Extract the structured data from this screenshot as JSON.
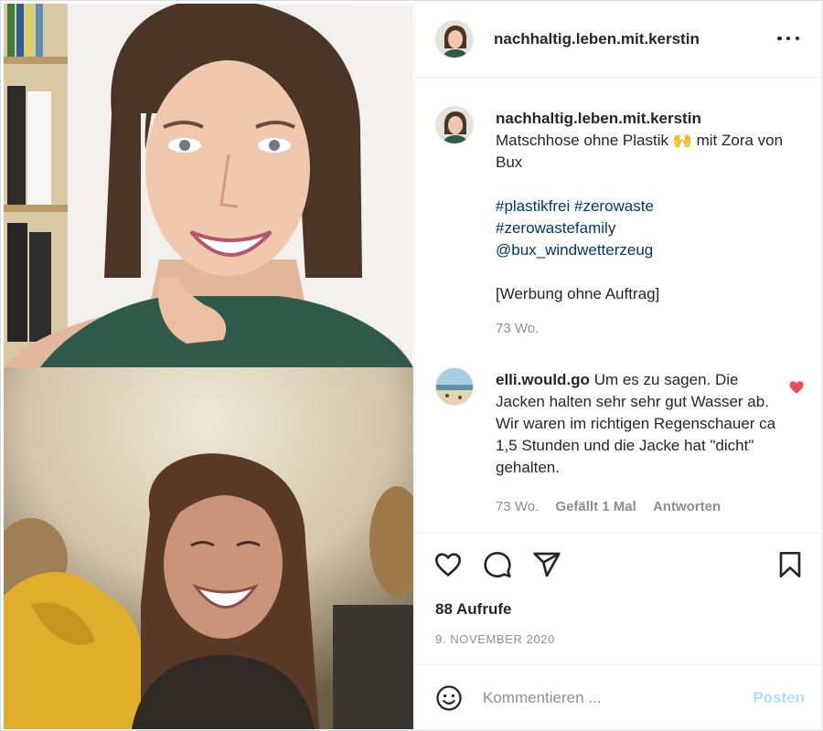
{
  "post": {
    "username": "nachhaltig.leben.mit.kerstin",
    "more_icon": "more-horizontal-icon"
  },
  "caption": {
    "username": "nachhaltig.leben.mit.kerstin",
    "line1": "Matschhose ohne Plastik 🙌 mit Zora von Bux",
    "hashtags": [
      "#plastikfrei",
      "#zerowaste",
      "#zerowastefamily",
      "@bux_windwetterzeug"
    ],
    "note": "[Werbung ohne Auftrag]",
    "time": "73 Wo."
  },
  "comment": {
    "username": "elli.would.go",
    "text": "Um es zu sagen. Die Jacken halten sehr sehr gut Wasser ab. Wir waren im richtigen Regenschauer ca 1,5 Stunden und die Jacke hat \"dicht\" gehalten.",
    "time": "73 Wo.",
    "likes": "Gefällt 1 Mal",
    "reply": "Antworten",
    "liked_color": "#ed4956"
  },
  "actions": {
    "icons": [
      "heart-icon",
      "comment-icon",
      "share-icon",
      "bookmark-icon"
    ],
    "views": "88 Aufrufe",
    "date": "9. NOVEMBER 2020"
  },
  "comment_box": {
    "placeholder": "Kommentieren ...",
    "post_label": "Posten",
    "post_color": "#b2dffc"
  }
}
